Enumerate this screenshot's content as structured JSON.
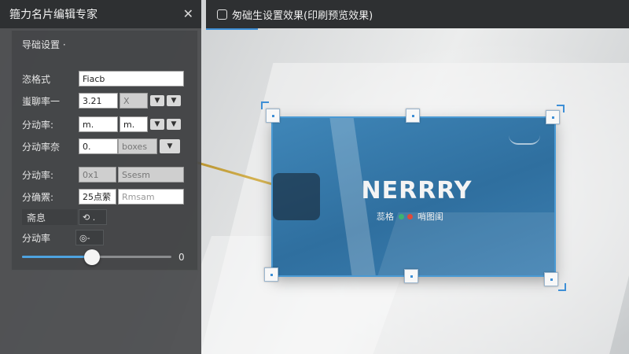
{
  "left_panel": {
    "title": "箍力名片编辑专家",
    "close_icon": "close-icon",
    "section_title": "导础设置 ·",
    "rows": [
      {
        "label": "恣格式",
        "value": "Fiacb"
      },
      {
        "label": "蚩聊率一",
        "value": "3.21",
        "value2": "X",
        "buttons": [
          "chevron-down-icon",
          "chevron-down-icon"
        ]
      },
      {
        "label": "分动率:",
        "value": "m.",
        "value2": "m.",
        "buttons": [
          "chevron-down-icon",
          "chevron-down-icon"
        ]
      },
      {
        "label": "分动率奈",
        "value": "0.",
        "value2": "boxes",
        "buttons": [
          "chevron-down-icon"
        ]
      },
      {
        "label": "分动率:",
        "value": "0x1",
        "value2": "Ssesm"
      },
      {
        "label": "分确罴:",
        "value": "25点萦",
        "value2": "Rmsam"
      },
      {
        "label": "斋息",
        "value": "⟲ ."
      },
      {
        "label": "分动率",
        "value": "◎-"
      }
    ],
    "slider": {
      "value_label": "0",
      "level": 0.47
    }
  },
  "right_panel": {
    "title": "匆础生设置效果(印刷预览效果)",
    "tab_icon": "preview-icon"
  },
  "card_preview": {
    "logo_text": "NERRRY",
    "subtitle_left": "蕊格",
    "subtitle_right": "哨图闺",
    "dot_colors": [
      "#3cb371",
      "#e04a3a"
    ],
    "accent": "#3e8fd6"
  }
}
